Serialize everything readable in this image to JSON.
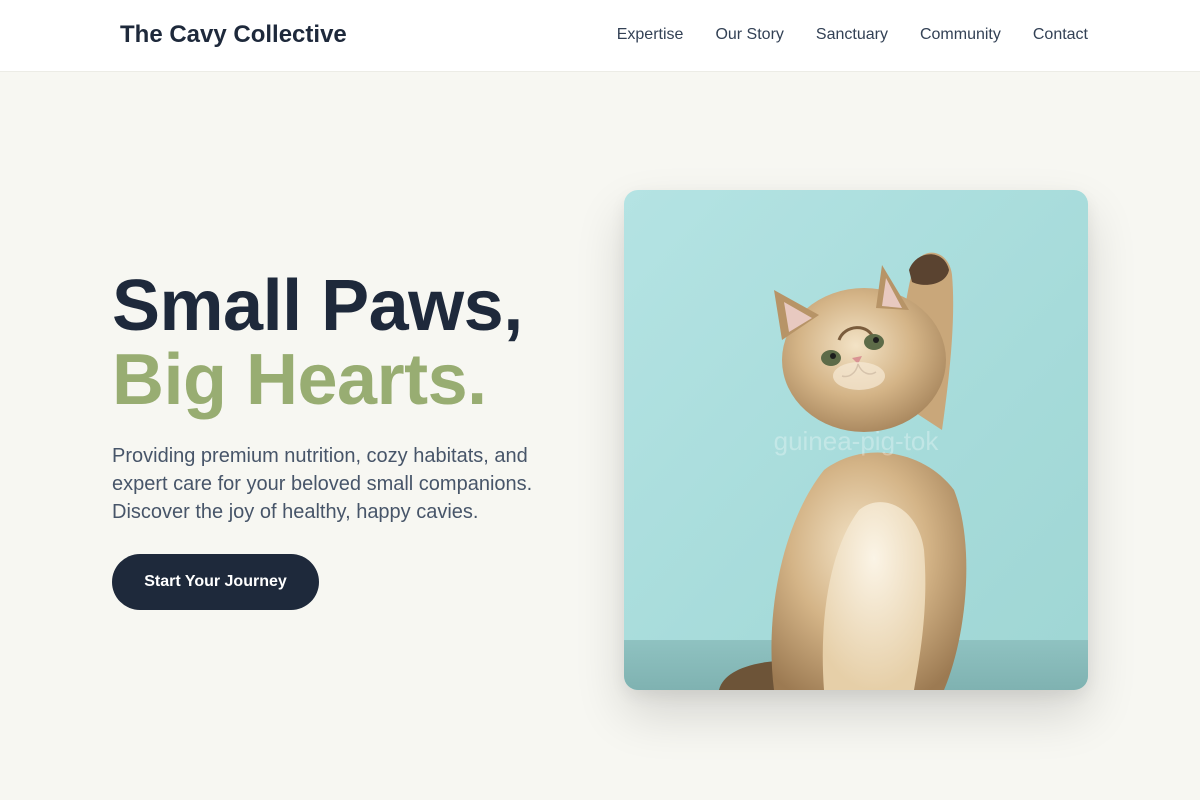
{
  "header": {
    "brand": "The Cavy Collective",
    "nav": [
      "Expertise",
      "Our Story",
      "Sanctuary",
      "Community",
      "Contact"
    ]
  },
  "hero": {
    "headline_line1": "Small Paws,",
    "headline_line2": "Big Hearts.",
    "subtitle": "Providing premium nutrition, cozy habitats, and expert care for your beloved small companions. Discover the joy of healthy, happy cavies.",
    "cta_label": "Start Your Journey",
    "image_watermark": "guinea-pig-tok"
  },
  "colors": {
    "background": "#f7f7f2",
    "primary_dark": "#1e293b",
    "accent_green": "#98ad72",
    "photo_backdrop": "#aee0df"
  },
  "icons": {
    "hero_image": "kitten-photo"
  }
}
